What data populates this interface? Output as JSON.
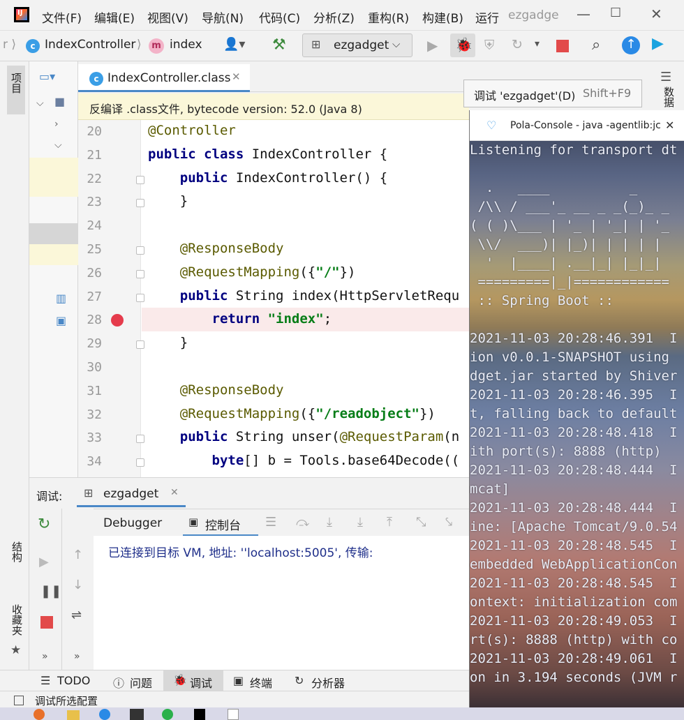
{
  "menu": {
    "items": [
      "文件(F)",
      "编辑(E)",
      "视图(V)",
      "导航(N)",
      "代码(C)",
      "分析(Z)",
      "重构(R)",
      "构建(B)",
      "运行"
    ],
    "window_title": "ezgadge"
  },
  "nav": {
    "class_crumb": "IndexController",
    "method_crumb": "index",
    "run_config": "ezgadget"
  },
  "left_tabs": {
    "project": "项目",
    "structure": "结构",
    "favorites": "收藏夹"
  },
  "editor": {
    "tab_label": "IndexController.class",
    "decompiled_notice": "反编译 .class文件, bytecode version: 52.0 (Java 8)",
    "lines": [
      {
        "n": "20",
        "text": "@Controller"
      },
      {
        "n": "21",
        "text": "public class IndexController {"
      },
      {
        "n": "22",
        "text": "    public IndexController() {"
      },
      {
        "n": "23",
        "text": "    }"
      },
      {
        "n": "24",
        "text": ""
      },
      {
        "n": "25",
        "text": "    @ResponseBody"
      },
      {
        "n": "26",
        "text": "    @RequestMapping({\"/\"})"
      },
      {
        "n": "27",
        "text": "    public String index(HttpServletRequ"
      },
      {
        "n": "28",
        "text": "        return \"index\";"
      },
      {
        "n": "29",
        "text": "    }"
      },
      {
        "n": "30",
        "text": ""
      },
      {
        "n": "31",
        "text": "    @ResponseBody"
      },
      {
        "n": "32",
        "text": "    @RequestMapping({\"/readobject\"})"
      },
      {
        "n": "33",
        "text": "    public String unser(@RequestParam(n"
      },
      {
        "n": "34",
        "text": "        byte[] b = Tools.base64Decode(("
      }
    ],
    "breakpoint_line": "28"
  },
  "debug": {
    "label": "调试:",
    "session": "ezgadget",
    "tabs": {
      "debugger": "Debugger",
      "console": "控制台"
    },
    "console_text": "已连接到目标 VM, 地址: ''localhost:5005', 传输:"
  },
  "bottom_tabs": [
    "TODO",
    "问题",
    "调试",
    "终端",
    "分析器"
  ],
  "status": {
    "text": "调试所选配置"
  },
  "tooltip": {
    "label": "调试 'ezgadget'(D)",
    "shortcut": "Shift+F9"
  },
  "right_strip": {
    "label": "数据"
  },
  "pola": {
    "title": "Pola-Console - java  -agentlib:jc",
    "lines": [
      "Listening for transport dt",
      "",
      "  .   ____          _",
      " /\\\\ / ___'_ __ _ _(_)_ _",
      "( ( )\\___ | '_ | '_| | '_",
      " \\\\/  ___)| |_)| | | | |",
      "  '  |____| .__|_| |_|_|",
      " =========|_|============",
      " :: Spring Boot ::",
      "",
      "2021-11-03 20:28:46.391  I",
      "ion v0.0.1-SNAPSHOT using",
      "dget.jar started by Shiver",
      "2021-11-03 20:28:46.395  I",
      "t, falling back to default",
      "2021-11-03 20:28:48.418  I",
      "ith port(s): 8888 (http)",
      "2021-11-03 20:28:48.444  I",
      "mcat]",
      "2021-11-03 20:28:48.444  I",
      "ine: [Apache Tomcat/9.0.54",
      "2021-11-03 20:28:48.545  I",
      "embedded WebApplicationCon",
      "2021-11-03 20:28:48.545  I",
      "ontext: initialization com",
      "2021-11-03 20:28:49.053  I",
      "rt(s): 8888 (http) with co",
      "2021-11-03 20:28:49.061  I",
      "on in 3.194 seconds (JVM r"
    ]
  },
  "colors": {
    "keyword": "#000080",
    "string": "#067d17",
    "breakpoint": "#e53b4c",
    "accent": "#4a88c7",
    "notice_bg": "#fbf7d9"
  }
}
